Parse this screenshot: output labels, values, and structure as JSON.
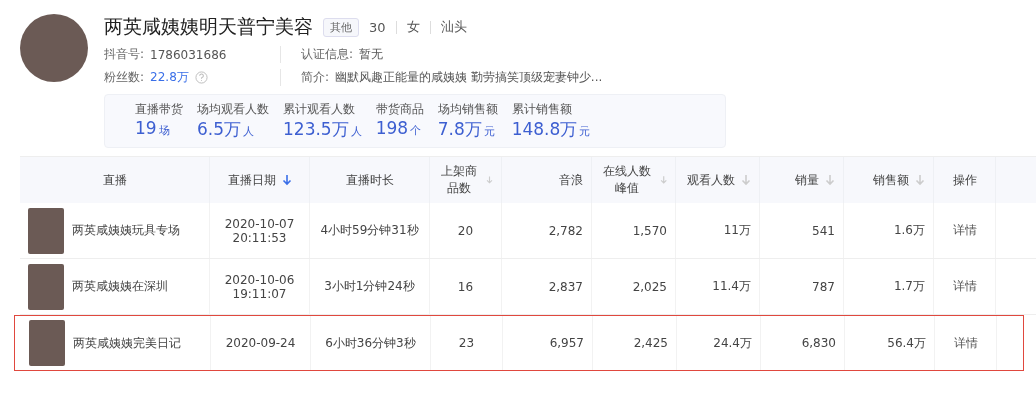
{
  "profile": {
    "name": "两英咸姨姨明天普宁美容",
    "tag": "其他",
    "age": "30",
    "gender": "女",
    "city": "汕头",
    "fields": [
      {
        "label": "抖音号:",
        "value": "1786031686",
        "kind": "plain"
      },
      {
        "label": "认证信息:",
        "value": "暂无",
        "kind": "plain"
      },
      {
        "label": "粉丝数:",
        "value": "22.8万",
        "kind": "link"
      },
      {
        "label": "简介:",
        "value": "幽默风趣正能量的咸姨姨 勤劳搞笑顶级宠妻钟少...",
        "kind": "plain"
      }
    ]
  },
  "stats": [
    {
      "label": "直播带货",
      "value": "19",
      "unit": "场"
    },
    {
      "label": "场均观看人数",
      "value": "6.5万",
      "unit": "人"
    },
    {
      "label": "累计观看人数",
      "value": "123.5万",
      "unit": "人"
    },
    {
      "label": "带货商品",
      "value": "198",
      "unit": "个"
    },
    {
      "label": "场均销售额",
      "value": "7.8万",
      "unit": "元"
    },
    {
      "label": "累计销售额",
      "value": "148.8万",
      "unit": "元"
    }
  ],
  "table": {
    "columns": [
      {
        "label": "直播",
        "sortable": false,
        "sorted": false
      },
      {
        "label": "直播日期",
        "sortable": true,
        "sorted": true
      },
      {
        "label": "直播时长",
        "sortable": false,
        "sorted": false
      },
      {
        "label": "上架商品数",
        "sortable": true,
        "sorted": false
      },
      {
        "label": "音浪",
        "sortable": false,
        "sorted": false
      },
      {
        "label": "在线人数峰值",
        "sortable": true,
        "sorted": false
      },
      {
        "label": "观看人数",
        "sortable": true,
        "sorted": false
      },
      {
        "label": "销量",
        "sortable": true,
        "sorted": false
      },
      {
        "label": "销售额",
        "sortable": true,
        "sorted": false
      },
      {
        "label": "操作",
        "sortable": false,
        "sorted": false
      }
    ],
    "rows": [
      {
        "highlighted": false,
        "cells": [
          "两英咸姨姨玩具专场",
          "2020-10-07 20:11:53",
          "4小时59分钟31秒",
          "20",
          "2,782",
          "1,570",
          "11万",
          "541",
          "1.6万",
          "详情"
        ]
      },
      {
        "highlighted": false,
        "cells": [
          "两英咸姨姨在深圳",
          "2020-10-06 19:11:07",
          "3小时1分钟24秒",
          "16",
          "2,837",
          "2,025",
          "11.4万",
          "787",
          "1.7万",
          "详情"
        ]
      },
      {
        "highlighted": true,
        "cells": [
          "两英咸姨姨完美日记",
          "2020-09-24",
          "6小时36分钟3秒",
          "23",
          "6,957",
          "2,425",
          "24.4万",
          "6,830",
          "56.4万",
          "详情"
        ]
      }
    ]
  }
}
